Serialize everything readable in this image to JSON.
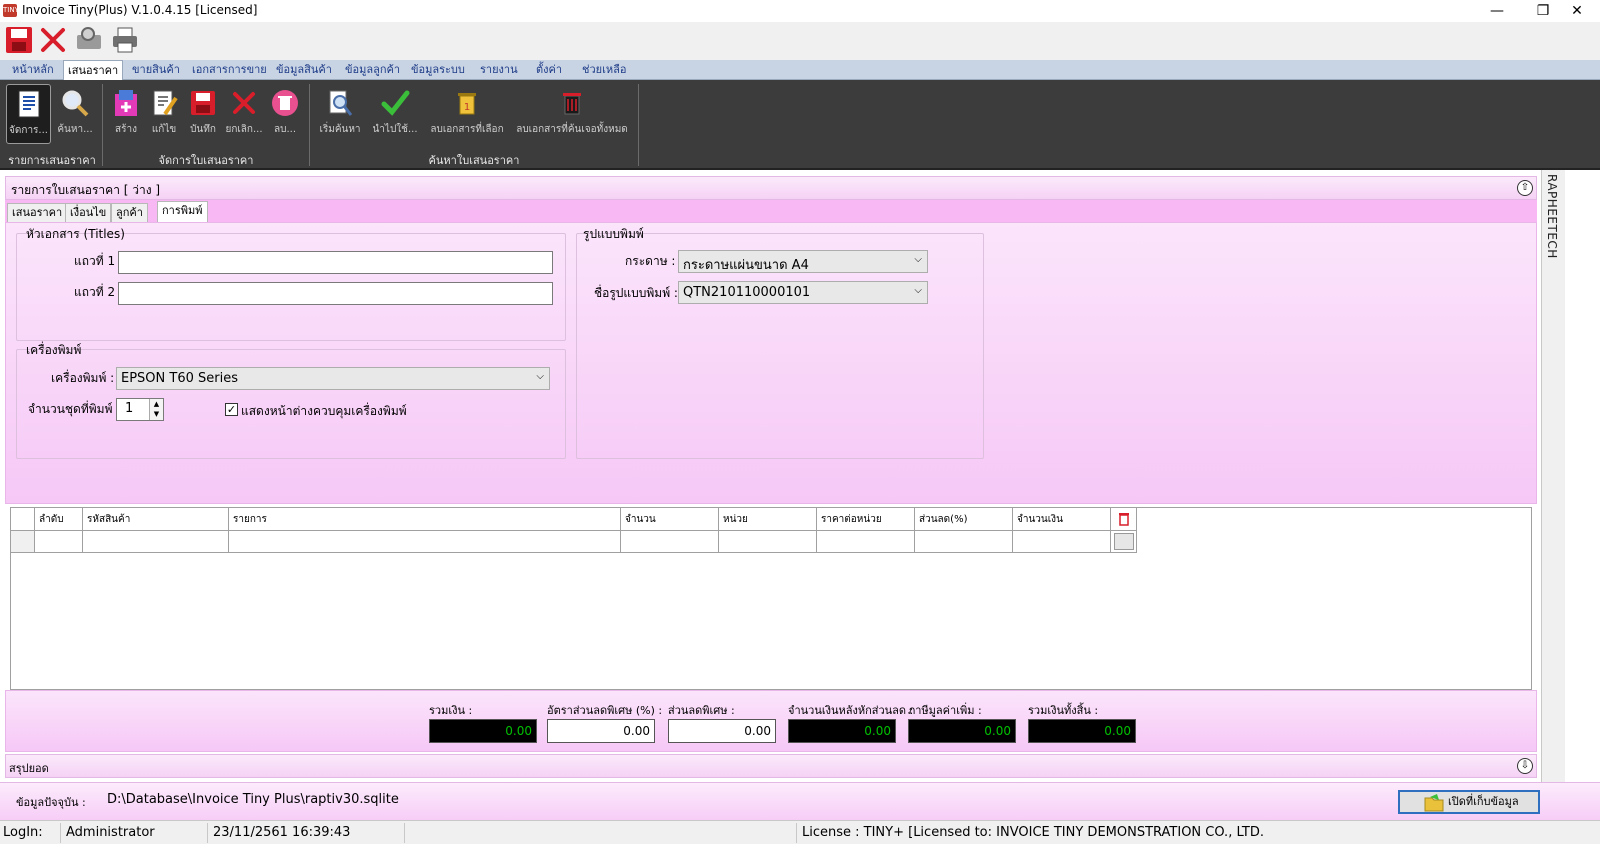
{
  "window": {
    "title": "Invoice Tiny(Plus)  V.1.0.4.15 [Licensed]",
    "app_icon_text": "TINY",
    "minimize": "—",
    "restore": "❐",
    "close": "✕"
  },
  "quick_access": [
    "save-icon",
    "close-icon",
    "preview-icon",
    "print-icon"
  ],
  "menu_tabs": [
    "หน้าหลัก",
    "เสนอราคา",
    "ขายสินค้า",
    "เอกสารการขาย",
    "ข้อมูลสินค้า",
    "ข้อมูลลูกค้า",
    "ข้อมูลระบบ",
    "รายงาน",
    "ตั้งค่า",
    "ช่วยเหลือ"
  ],
  "ribbon": {
    "buttons": [
      "จัดการ...",
      "ค้นหา...",
      "สร้าง",
      "แก้ไข",
      "บันทึก",
      "ยกเลิก...",
      "ลบ...",
      "เริ่มค้นหา",
      "นำไปใช้...",
      "ลบเอกสารที่เลือก",
      "ลบเอกสารที่ค้นเจอทั้งหมด"
    ],
    "groups": [
      "รายการเสนอราคา",
      "จัดการใบเสนอราคา",
      "ค้นหาใบเสนอราคา"
    ]
  },
  "list_header": {
    "title": "รายการใบเสนอราคา [ ว่าง ]",
    "collapse": "⇧"
  },
  "sub_tabs": [
    "เสนอราคา",
    "เงื่อนไข",
    "ลูกค้า",
    "การพิมพ์"
  ],
  "titles_group": {
    "title": "หัวเอกสาร (Titles)",
    "line1_label": "แถวที่ 1",
    "line1_value": "",
    "line2_label": "แถวที่ 2",
    "line2_value": ""
  },
  "printer_group": {
    "title": "เครื่องพิมพ์",
    "printer_label": "เครื่องพิมพ์ :",
    "printer_value": "EPSON T60 Series",
    "copies_label": "จำนวนชุดที่พิมพ์ :",
    "copies_value": "1",
    "show_dialog_label": "แสดงหน้าต่างควบคุมเครื่องพิมพ์",
    "show_dialog_checked": true
  },
  "format_group": {
    "title": "รูปแบบพิมพ์",
    "paper_label": "กระดาษ :",
    "paper_value": "กระดาษแผ่นขนาด A4",
    "format_label": "ชื่อรูปแบบพิมพ์ :",
    "format_value": "QTN210110000101"
  },
  "grid": {
    "columns": [
      "ลำดับ",
      "รหัสสินค้า",
      "รายการ",
      "จำนวน",
      "หน่วย",
      "ราคาต่อหน่วย",
      "ส่วนลด(%)",
      "จำนวนเงิน"
    ]
  },
  "totals": [
    {
      "label": "รวมเงิน :",
      "value": "0.00",
      "style": "dark"
    },
    {
      "label": "อัตราส่วนลดพิเศษ (%) :",
      "value": "0.00",
      "style": "light"
    },
    {
      "label": "ส่วนลดพิเศษ :",
      "value": "0.00",
      "style": "light"
    },
    {
      "label": "จำนวนเงินหลังหักส่วนลด :",
      "value": "0.00",
      "style": "dark"
    },
    {
      "label": "ภาษีมูลค่าเพิ่ม :",
      "value": "0.00",
      "style": "dark"
    },
    {
      "label": "รวมเงินทั้งสิ้น :",
      "value": "0.00",
      "style": "dark"
    }
  ],
  "summary": {
    "title": "สรุปยอด",
    "expand": "⇩"
  },
  "side_label": "RAPHEETECH",
  "path_bar": {
    "label": "ข้อมูลปัจจุบัน :",
    "path": "D:\\Database\\Invoice Tiny Plus\\raptiv30.sqlite",
    "open_button": "เปิดที่เก็บข้อมูล"
  },
  "status_bar": {
    "login_label": "LogIn:",
    "user": "Administrator",
    "datetime": "23/11/2561 16:39:43",
    "license": "License : TINY+ [Licensed to: INVOICE TINY DEMONSTRATION CO., LTD."
  },
  "colors": {
    "ribbon_bg": "#3c3c3c",
    "pink_panel": "#f6c8f6",
    "menu_bg": "#c8d4e4",
    "total_dark_bg": "#000000",
    "total_dark_text": "#00c000"
  }
}
